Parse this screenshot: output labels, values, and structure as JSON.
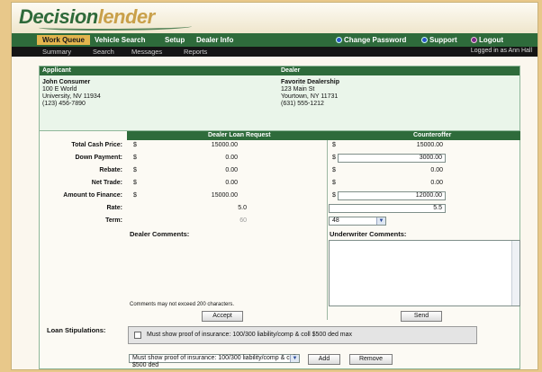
{
  "app": {
    "logo_part1": "Decision",
    "logo_part2": "lender"
  },
  "topnav": {
    "items": [
      "Work Queue",
      "Vehicle Search",
      "Setup",
      "Dealer Info"
    ],
    "right": [
      "Change Password",
      "Support",
      "Logout"
    ]
  },
  "subnav": {
    "items": [
      "Summary",
      "Search",
      "Messages",
      "Reports"
    ],
    "logged_in": "Logged in as  Ann Hall"
  },
  "applicant": {
    "label": "Applicant",
    "lines": [
      "John Consumer",
      "100 E World",
      "University, NV 11934",
      "(123) 456-7890"
    ]
  },
  "dealer": {
    "label": "Dealer",
    "lines": [
      "Favorite Dealership",
      "123 Main St",
      "Yourtown, NY 11731",
      "(631) 555-1212"
    ]
  },
  "loan": {
    "request_title": "Dealer Loan Request",
    "counter_title": "Counteroffer",
    "dollar": "$",
    "rows": [
      {
        "label": "Total Cash Price:",
        "request": "15000.00",
        "counter": "15000.00"
      },
      {
        "label": "Down Payment:",
        "request": "0.00",
        "counter": "3000.00"
      },
      {
        "label": "Rebate:",
        "request": "0.00",
        "counter": "0.00"
      },
      {
        "label": "Net Trade:",
        "request": "0.00",
        "counter": "0.00"
      },
      {
        "label": "Amount to Finance:",
        "request": "15000.00",
        "counter": "12000.00"
      },
      {
        "label": "Rate:",
        "request": "5.0",
        "counter": "5.5"
      },
      {
        "label": "Term:",
        "request": "60",
        "counter": "48"
      }
    ],
    "dealer_comments_label": "Dealer Comments:",
    "underwriter_comments_label": "Underwriter Comments:",
    "comment_note": "Comments may not exceed 200 characters.",
    "accept": "Accept",
    "send": "Send"
  },
  "stipulations": {
    "label": "Loan Stipulations:",
    "item": "Must show proof of insurance: 100/300 liability/comp & coll $500 ded max",
    "select_value": "Must show proof of insurance: 100/300 liability/comp & coll $500 ded",
    "add": "Add",
    "remove": "Remove"
  }
}
